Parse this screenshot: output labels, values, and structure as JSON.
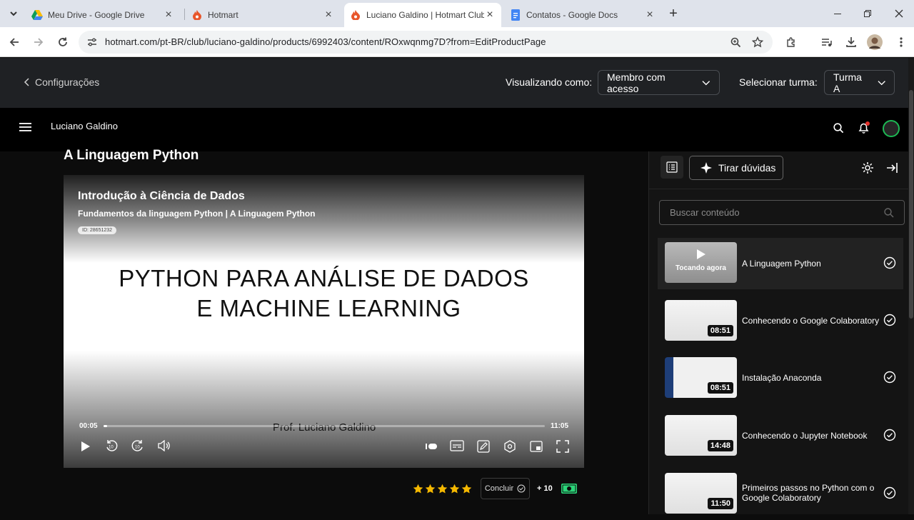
{
  "browser": {
    "tabs": [
      {
        "label": "Meu Drive - Google Drive",
        "icon": "google-drive-icon"
      },
      {
        "label": "Hotmart",
        "icon": "hotmart-flame-icon"
      },
      {
        "label": "Luciano Galdino | Hotmart Club",
        "icon": "hotmart-flame-icon"
      },
      {
        "label": "Contatos - Google Docs",
        "icon": "google-docs-icon"
      }
    ],
    "url": "hotmart.com/pt-BR/club/luciano-galdino/products/6992403/content/ROxwqnmg7D?from=EditProductPage"
  },
  "config": {
    "back_label": "Configurações",
    "viewing_label": "Visualizando como:",
    "viewing_value": "Membro com acesso",
    "class_label": "Selecionar turma:",
    "class_value": "Turma A"
  },
  "club": {
    "name": "Luciano Galdino"
  },
  "lesson": {
    "title": "A Linguagem Python"
  },
  "video": {
    "header_title": "Introdução à Ciência de Dados",
    "header_subtitle": "Fundamentos da linguagem Python | A Linguagem Python",
    "id_badge": "ID: 28651232",
    "slide_line1": "PYTHON PARA ANÁLISE DE DADOS",
    "slide_line2": "E MACHINE LEARNING",
    "author": "Prof. Luciano Galdino",
    "current_time": "00:05",
    "total_time": "11:05",
    "progress": 0.008
  },
  "actions": {
    "rating_stars": 5,
    "complete_label": "Concluir",
    "points": "+ 10"
  },
  "sidebar": {
    "ask_label": "Tirar dúvidas",
    "search_placeholder": "Buscar conteúdo",
    "items": [
      {
        "title": "A Linguagem Python",
        "status": "Tocando agora"
      },
      {
        "title": "Conhecendo o Google Colaboratory",
        "duration": "08:51"
      },
      {
        "title": "Instalação Anaconda",
        "duration": "08:51"
      },
      {
        "title": "Conhecendo o Jupyter Notebook",
        "duration": "14:48"
      },
      {
        "title": "Primeiros passos no Python com o Google Colaboratory",
        "duration": "11:50"
      }
    ]
  },
  "colors": {
    "accent_green": "#1db954",
    "points_badge": "#2cd67a",
    "star": "#f5b800",
    "notification_dot": "#e5312b"
  }
}
